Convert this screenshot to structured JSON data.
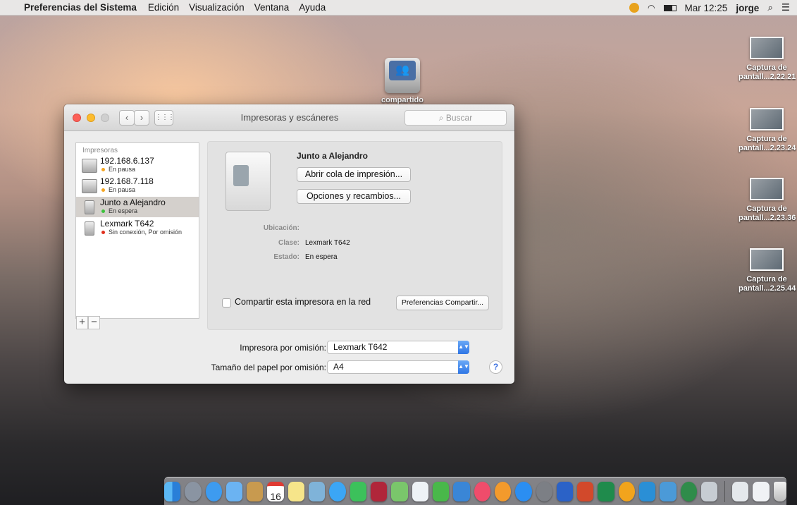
{
  "menubar": {
    "apple": "",
    "app_name": "Preferencias del Sistema",
    "menus": [
      "Edición",
      "Visualización",
      "Ventana",
      "Ayuda"
    ],
    "clock": "Mar 12:25",
    "user": "jorge"
  },
  "desktop": {
    "drive_label": "compartido",
    "screenshots": [
      {
        "line1": "Captura de",
        "line2": "pantall...2.22.21"
      },
      {
        "line1": "Captura de",
        "line2": "pantall...2.23.24"
      },
      {
        "line1": "Captura de",
        "line2": "pantall...2.23.36"
      },
      {
        "line1": "Captura de",
        "line2": "pantall...2.25.44"
      }
    ]
  },
  "window": {
    "title": "Impresoras y escáneres",
    "search_placeholder": "Buscar",
    "nav_back": "‹",
    "nav_forward": "›",
    "grid": "⋮⋮⋮",
    "sidebar_header": "Impresoras",
    "printers": [
      {
        "name": "192.168.6.137",
        "status": "En pausa",
        "status_color": "#f5a623"
      },
      {
        "name": "192.168.7.118",
        "status": "En pausa",
        "status_color": "#f5a623"
      },
      {
        "name": "Junto a Alejandro",
        "status": "En espera",
        "status_color": "#3cc13c",
        "selected": true
      },
      {
        "name": "Lexmark T642",
        "status": "Sin conexión, Por omisión",
        "status_color": "#e0301e"
      }
    ],
    "add_label": "+",
    "remove_label": "−",
    "detail": {
      "name": "Junto a Alejandro",
      "open_queue": "Abrir cola de impresión...",
      "options": "Opciones y recambios...",
      "location_label": "Ubicación:",
      "location_value": "",
      "class_label": "Clase:",
      "class_value": "Lexmark T642",
      "state_label": "Estado:",
      "state_value": "En espera",
      "share_label": "Compartir esta impresora en la red",
      "share_prefs": "Preferencias Compartir..."
    },
    "default_printer_label": "Impresora por omisión:",
    "default_printer_value": "Lexmark T642",
    "paper_size_label": "Tamaño del papel por omisión:",
    "paper_size_value": "A4",
    "help": "?"
  },
  "colors": {
    "close": "#fc5f57",
    "minimize": "#fdbc2e",
    "zoom": "#cfcfcf",
    "accent": "#2f76e5"
  },
  "dock": {
    "apps": [
      "finder-icon",
      "launchpad-icon",
      "safari-icon",
      "mail-icon",
      "notes-icon",
      "calendar-icon",
      "stickies-icon",
      "preview-icon",
      "messages-icon",
      "facetime-icon",
      "photobooth-icon",
      "maps-icon",
      "textedit-icon",
      "numbers-icon",
      "keynote-icon",
      "itunes-icon",
      "ibooks-icon",
      "appstore-icon",
      "systemprefs-icon",
      "word-icon",
      "powerpoint-icon",
      "excel-icon",
      "outlook-icon",
      "onenote-icon",
      "xcode-icon",
      "vpn-icon",
      "screenshot-icon"
    ],
    "trailing": [
      "downloads-folder-icon",
      "documents-folder-icon",
      "trash-icon"
    ],
    "calendar_day": "16"
  }
}
